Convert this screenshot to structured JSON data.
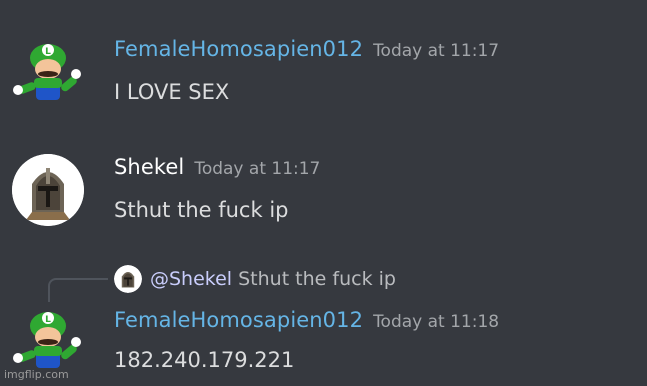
{
  "messages": [
    {
      "username": "FemaleHomosapien012",
      "username_color": "#65b5e6",
      "timestamp": "Today at 11:17",
      "content": "I LOVE SEX",
      "avatar": "luigi-avatar"
    },
    {
      "username": "Shekel",
      "username_color": "#ffffff",
      "timestamp": "Today at 11:17",
      "content": "Sthut the fuck ip",
      "avatar": "helmet-avatar"
    },
    {
      "reply": {
        "mention": "@Shekel",
        "text": "Sthut the fuck ip",
        "avatar": "helmet-avatar"
      },
      "username": "FemaleHomosapien012",
      "username_color": "#65b5e6",
      "timestamp": "Today at 11:18",
      "content": "182.240.179.221",
      "avatar": "luigi-avatar"
    }
  ],
  "watermark": "imgflip.com"
}
